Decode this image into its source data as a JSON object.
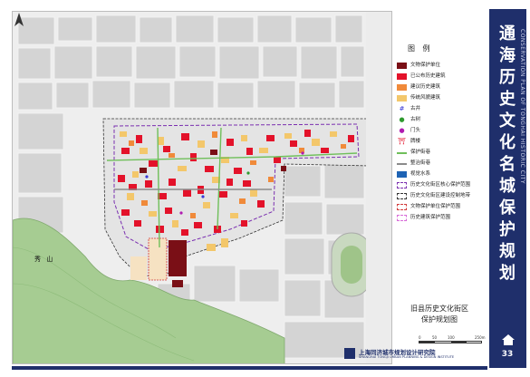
{
  "page": {
    "number": "33",
    "cn_title": "通海历史文化名城保护规划",
    "en_title": "CONSERVATION PLAN OF TONGHAI HISTORIC CITY"
  },
  "legend": {
    "title": "图 例",
    "items": [
      {
        "label": "文物保护单位",
        "color": "#7a0f16",
        "icon": "solid-swatch"
      },
      {
        "label": "已公布历史建筑",
        "color": "#e3122a",
        "icon": "solid-swatch"
      },
      {
        "label": "建议历史建筑",
        "color": "#f08a3a",
        "icon": "solid-swatch"
      },
      {
        "label": "传统风貌建筑",
        "color": "#f3c76b",
        "icon": "solid-swatch"
      },
      {
        "label": "古井",
        "color": "#3a3ad6",
        "icon": "well-icon"
      },
      {
        "label": "古树",
        "color": "#2e9a2e",
        "icon": "tree-icon"
      },
      {
        "label": "门头",
        "color": "#b01bb0",
        "icon": "gate-icon"
      },
      {
        "label": "牌楼",
        "color": "#e3122a",
        "icon": "archway-icon"
      },
      {
        "label": "保护街巷",
        "color": "#6fbf5a",
        "icon": "line-swatch"
      },
      {
        "label": "整治街巷",
        "color": "#8b8b8b",
        "icon": "line-swatch"
      },
      {
        "label": "视觉水系",
        "color": "#1e63b4",
        "icon": "solid-swatch"
      },
      {
        "label": "历史文化街区核心保护范围",
        "color": "#7a2fb0",
        "icon": "dashed-swatch"
      },
      {
        "label": "历史文化街区建设控制地带",
        "color": "#333333",
        "icon": "dashed-swatch"
      },
      {
        "label": "文物保护单位保护范围",
        "color": "#d23a3a",
        "icon": "dashed-swatch"
      },
      {
        "label": "历史建筑保护范围",
        "color": "#d86ad8",
        "icon": "dashed-swatch"
      }
    ]
  },
  "map": {
    "map_title_line1": "旧县历史文化街区",
    "map_title_line2": "保护规划图",
    "hill_label": "秀  山",
    "scale_labels": [
      "0",
      "50",
      "100",
      "250m"
    ]
  },
  "institute": {
    "name_cn": "上海同济城市规划设计研究院",
    "name_en": "SHANGHAI TONGJI URBAN PLANNING & DESIGN INSTITUTE"
  },
  "colors": {
    "brand_blue": "#1f2f6b",
    "hill_green": "#9dc48a",
    "block_grey": "#d6d6d6"
  }
}
